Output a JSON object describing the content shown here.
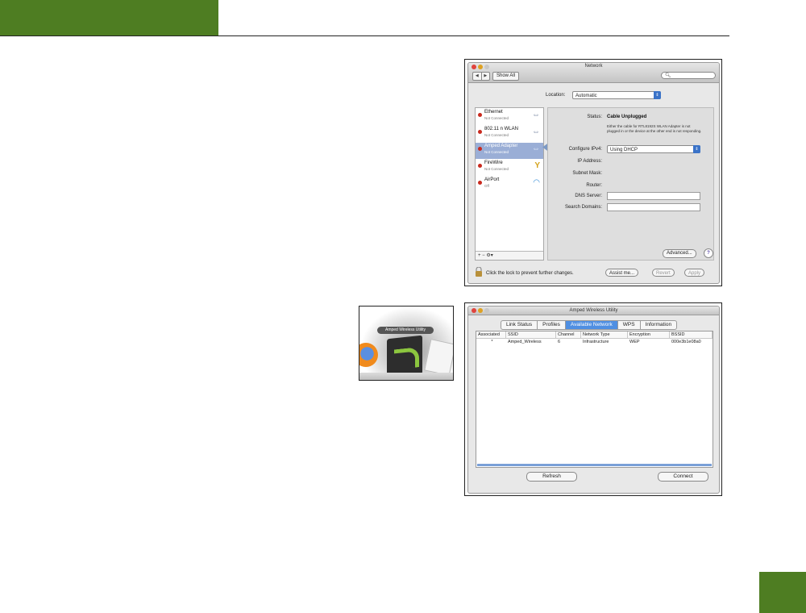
{
  "page": {
    "accent_color": "#4e7d22"
  },
  "network_window": {
    "title": "Network",
    "nav_back": "◀",
    "nav_forward": "▶",
    "show_all": "Show All",
    "search_icon": "search-icon",
    "location_label": "Location:",
    "location_value": "Automatic",
    "services": [
      {
        "name": "Ethernet",
        "status": "Not Connected",
        "icon": "⇔",
        "selected": false
      },
      {
        "name": "802.11 n WLAN",
        "status": "Not Connected",
        "icon": "⇔",
        "selected": false
      },
      {
        "name": "Amped Adapter",
        "status": "Not Connected",
        "icon": "⇔",
        "selected": true
      },
      {
        "name": "FireWire",
        "status": "Not Connected",
        "icon": "Y",
        "selected": false
      },
      {
        "name": "AirPort",
        "status": "Off",
        "icon": "◠",
        "selected": false
      }
    ],
    "list_toolbar": "+   −   ⚙▾",
    "status_label": "Status:",
    "status_value": "Cable Unplugged",
    "status_desc": "Either the cable for RTL8192S WLAN Adapter is not plugged in or the device at the other end is not responding.",
    "configure_label": "Configure IPv4:",
    "configure_value": "Using DHCP",
    "ip_label": "IP Address:",
    "subnet_label": "Subnet Mask:",
    "router_label": "Router:",
    "dns_label": "DNS Server:",
    "search_domains_label": "Search Domains:",
    "advanced_button": "Advanced...",
    "help_button": "?",
    "lock_text": "Click the lock to prevent further changes.",
    "assist_button": "Assist me...",
    "revert_button": "Revert",
    "apply_button": "Apply"
  },
  "dock": {
    "tooltip": "Amped Wireless Utility"
  },
  "utility_window": {
    "title": "Amped Wireless Utility",
    "tabs": [
      "Link Status",
      "Profiles",
      "Available Network",
      "WPS",
      "Information"
    ],
    "active_tab": "Available Network",
    "columns": [
      "Associated",
      "SSID",
      "Channel",
      "Network Type",
      "Encryption",
      "BSSID"
    ],
    "rows": [
      [
        "*",
        "Amped_Wireless",
        "6",
        "Infrastructure",
        "WEP",
        "000e3b1e08a0"
      ]
    ],
    "refresh_button": "Refresh",
    "connect_button": "Connect"
  }
}
